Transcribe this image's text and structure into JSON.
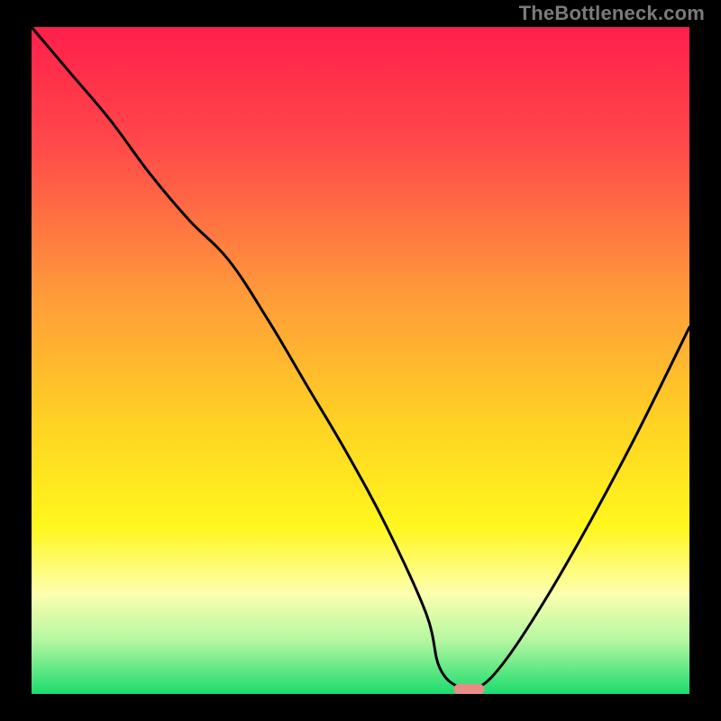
{
  "watermark": "TheBottleneck.com",
  "colors": {
    "frame": "#000000",
    "watermark_text": "#7b7b7b",
    "curve": "#000000",
    "marker_fill": "#e88d85",
    "gradient_stops": [
      {
        "offset": 0.0,
        "color": "#ff1f4b"
      },
      {
        "offset": 0.18,
        "color": "#ff4a4a"
      },
      {
        "offset": 0.4,
        "color": "#ff9a3a"
      },
      {
        "offset": 0.6,
        "color": "#ffd423"
      },
      {
        "offset": 0.75,
        "color": "#fff71d"
      },
      {
        "offset": 0.85,
        "color": "#fdffb0"
      },
      {
        "offset": 0.92,
        "color": "#b4f7a0"
      },
      {
        "offset": 1.0,
        "color": "#1bdc6e"
      }
    ]
  },
  "chart_data": {
    "type": "line",
    "title": "",
    "xlabel": "",
    "ylabel": "",
    "xlim": [
      0,
      100
    ],
    "ylim": [
      0,
      100
    ],
    "x": [
      0,
      6,
      12,
      18,
      24,
      30,
      36,
      42,
      48,
      54,
      60,
      62,
      65,
      68,
      72,
      78,
      85,
      92,
      100
    ],
    "values": [
      100,
      93,
      86,
      78,
      71,
      65,
      56,
      46,
      36,
      25,
      12,
      4,
      1,
      1,
      5,
      14,
      26,
      39,
      55
    ],
    "min_marker": {
      "x": 66.5,
      "y": 0.7
    },
    "notes": "V-shaped bottleneck curve over a vertical red-to-green heat gradient; minimum near x≈66.5."
  }
}
